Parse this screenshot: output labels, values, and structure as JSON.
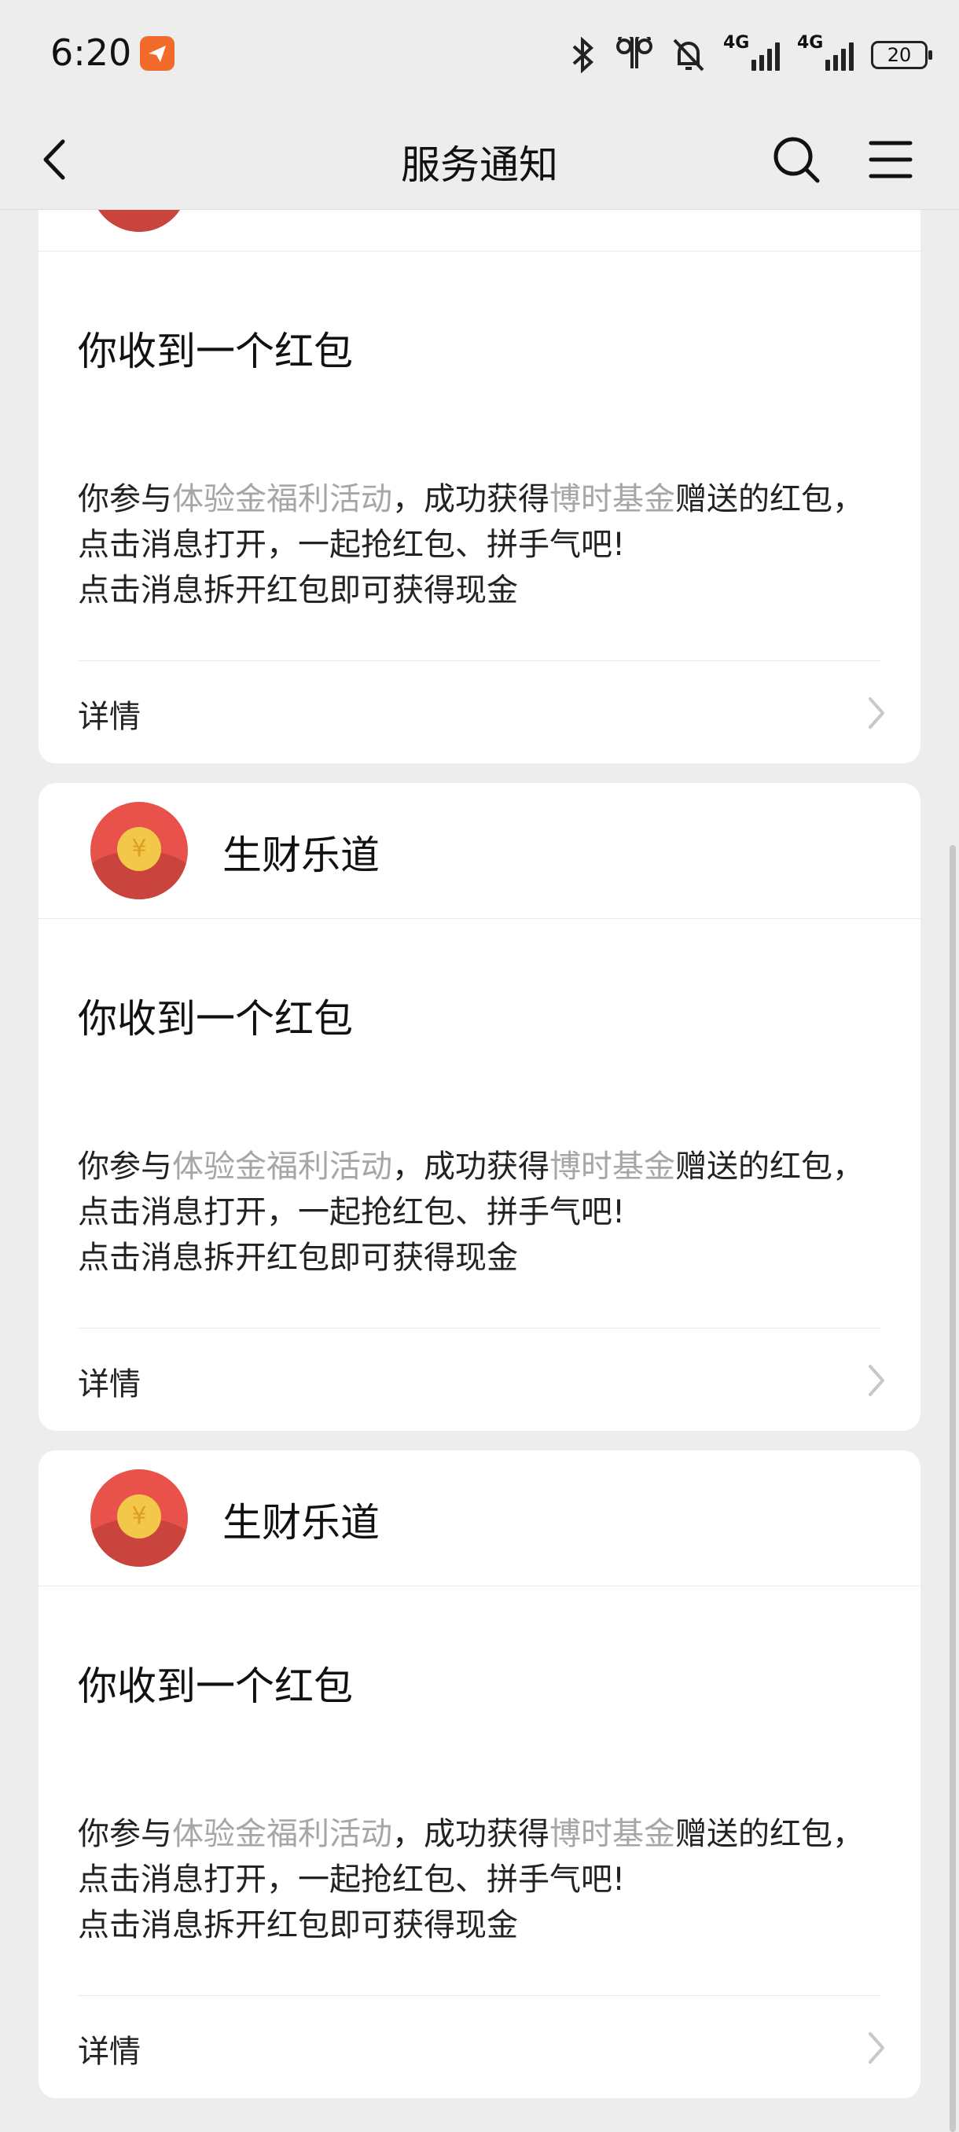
{
  "status_bar": {
    "time": "6:20",
    "battery": "20",
    "network_1": "4G",
    "network_2": "4G"
  },
  "nav": {
    "title": "服务通知"
  },
  "cards": [
    {
      "sender": "",
      "title": "你收到一个红包",
      "body_prefix": "你参与",
      "activity": "体验金福利活动",
      "body_mid": "，成功获得",
      "fund": "博时基金",
      "body_suffix": "赠送的红包，点击消息打开，一起抢红包、拼手气吧!",
      "body_line2": "点击消息拆开红包即可获得现金",
      "detail": "详情"
    },
    {
      "sender": "生财乐道",
      "title": "你收到一个红包",
      "body_prefix": "你参与",
      "activity": "体验金福利活动",
      "body_mid": "，成功获得",
      "fund": "博时基金",
      "body_suffix": "赠送的红包，点击消息打开，一起抢红包、拼手气吧!",
      "body_line2": "点击消息拆开红包即可获得现金",
      "detail": "详情"
    },
    {
      "sender": "生财乐道",
      "title": "你收到一个红包",
      "body_prefix": "你参与",
      "activity": "体验金福利活动",
      "body_mid": "，成功获得",
      "fund": "博时基金",
      "body_suffix": "赠送的红包，点击消息打开，一起抢红包、拼手气吧!",
      "body_line2": "点击消息拆开红包即可获得现金",
      "detail": "详情"
    }
  ],
  "icons": {
    "back": "chevron-left-icon",
    "search": "search-icon",
    "menu": "hamburger-menu-icon",
    "avatar": "red-packet-icon",
    "coin_symbol": "¥"
  },
  "colors": {
    "background": "#ededed",
    "card": "#ffffff",
    "highlight_text": "#a6a6a6",
    "red_packet": "#e9524a",
    "coin": "#f3c84a"
  }
}
